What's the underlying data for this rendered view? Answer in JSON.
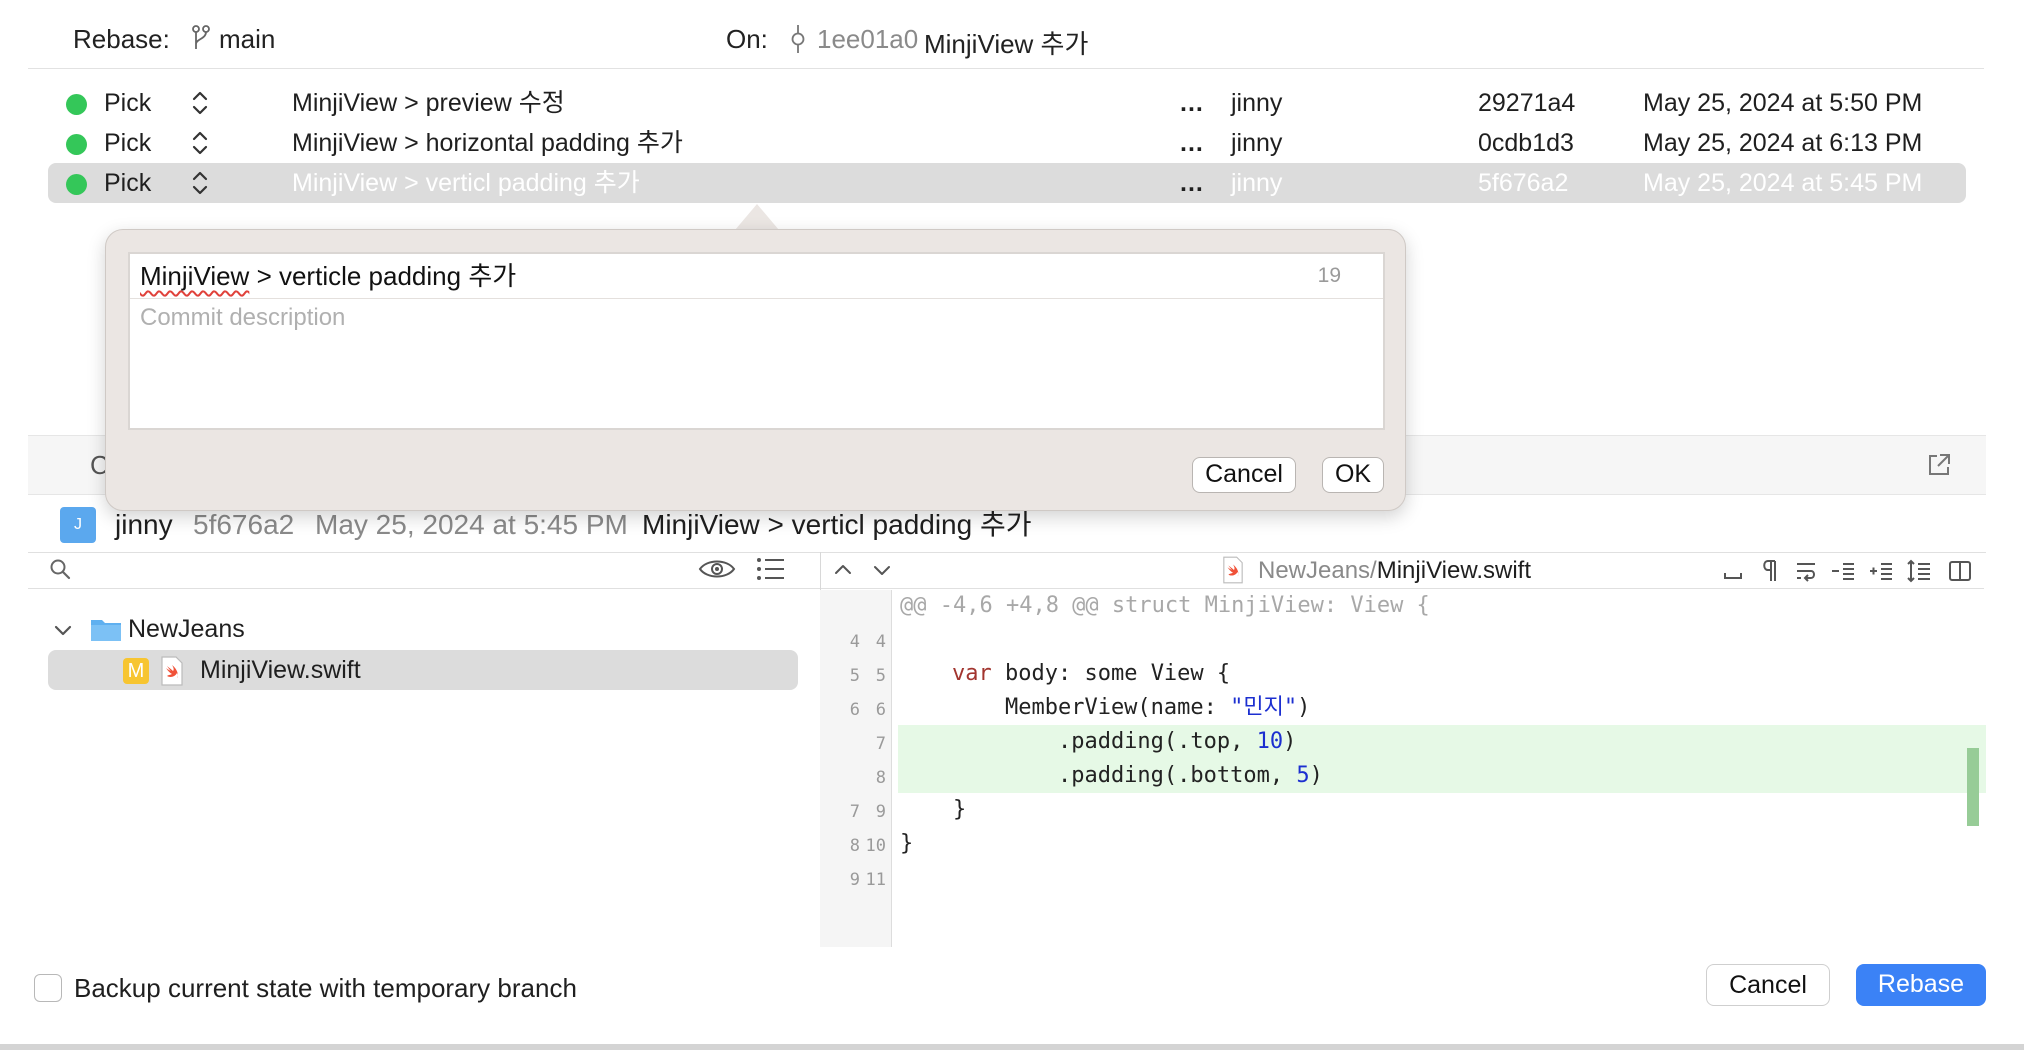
{
  "header": {
    "rebase_label": "Rebase:",
    "branch": "main",
    "on_label": "On:",
    "on_hash": "1ee01a0",
    "on_message": "MinjiView 추가"
  },
  "commits": [
    {
      "action": "Pick",
      "message": "MinjiView > preview 수정",
      "author": "jinny",
      "hash": "29271a4",
      "date": "May 25, 2024 at 5:50 PM",
      "selected": false
    },
    {
      "action": "Pick",
      "message": "MinjiView > horizontal padding 추가",
      "author": "jinny",
      "hash": "0cdb1d3",
      "date": "May 25, 2024 at 6:13 PM",
      "selected": false
    },
    {
      "action": "Pick",
      "message": "MinjiView > verticl padding 추가",
      "author": "jinny",
      "hash": "5f676a2",
      "date": "May 25, 2024 at 5:45 PM",
      "selected": true
    }
  ],
  "ellipsis": "...",
  "popover": {
    "title_word1": "MinjiView",
    "title_rest": " > verticle padding 추가",
    "char_count": "19",
    "description_placeholder": "Commit description",
    "cancel_label": "Cancel",
    "ok_label": "OK"
  },
  "section_partial_label": "C",
  "commit_info": {
    "avatar_letter": "J",
    "author": "jinny",
    "hash": "5f676a2",
    "date": "May 25, 2024 at 5:45 PM",
    "message": "MinjiView > verticl padding 추가"
  },
  "file_tree": {
    "folder": "NewJeans",
    "file_status": "M",
    "file": "MinjiView.swift"
  },
  "diff": {
    "path_dir": "NewJeans/",
    "path_file": "MinjiView.swift",
    "hunk_header": "@@ -4,6 +4,8 @@ struct MinjiView: View {",
    "lines": [
      {
        "old": "4",
        "new": "4",
        "text": ""
      },
      {
        "old": "5",
        "new": "5",
        "kw": "var",
        "text": " body: some View {"
      },
      {
        "old": "6",
        "new": "6",
        "pre": "    MemberView(name: ",
        "str": "\"민지\"",
        "post": ")"
      },
      {
        "old": "",
        "new": "7",
        "pre": "        .padding(.top, ",
        "num": "10",
        "post": ")",
        "added": true
      },
      {
        "old": "",
        "new": "8",
        "pre": "        .padding(.bottom, ",
        "num": "5",
        "post": ")",
        "added": true
      },
      {
        "old": "7",
        "new": "9",
        "text": "    }"
      },
      {
        "old": "8",
        "new": "10",
        "text": "}"
      },
      {
        "old": "9",
        "new": "11",
        "text": ""
      }
    ]
  },
  "footer": {
    "backup_label": "Backup current state with temporary branch",
    "cancel_label": "Cancel",
    "rebase_label": "Rebase"
  },
  "colors": {
    "accent": "#3b82f6",
    "pick_dot": "#34c759",
    "added_line_bg": "#e6f9e6",
    "keyword": "#a2352f",
    "literal": "#1c2fd0"
  }
}
